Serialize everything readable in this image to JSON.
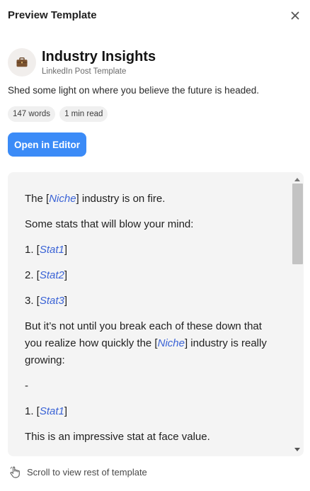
{
  "header": {
    "title": "Preview Template",
    "close_icon": "close-icon"
  },
  "template": {
    "icon": "briefcase-icon",
    "title": "Industry Insights",
    "subtitle": "LinkedIn Post Template",
    "description": "Shed some light on where you believe the future is headed.",
    "badges": [
      "147 words",
      "1 min read"
    ],
    "open_button": "Open in Editor",
    "accent_color": "#3b8bf7",
    "placeholder_color": "#3a63d6"
  },
  "preview": {
    "lines": [
      {
        "parts": [
          {
            "t": "The ["
          },
          {
            "t": "Niche",
            "ph": true
          },
          {
            "t": "] industry is on fire."
          }
        ]
      },
      {
        "parts": [
          {
            "t": "Some stats that will blow your mind:"
          }
        ]
      },
      {
        "parts": [
          {
            "t": "1. ["
          },
          {
            "t": "Stat1",
            "ph": true
          },
          {
            "t": "]"
          }
        ]
      },
      {
        "parts": [
          {
            "t": "2. ["
          },
          {
            "t": "Stat2",
            "ph": true
          },
          {
            "t": "]"
          }
        ]
      },
      {
        "parts": [
          {
            "t": "3. ["
          },
          {
            "t": "Stat3",
            "ph": true
          },
          {
            "t": "]"
          }
        ]
      },
      {
        "parts": [
          {
            "t": "But it’s not until you break each of these down that you realize how quickly the ["
          },
          {
            "t": "Niche",
            "ph": true
          },
          {
            "t": "] industry is really growing:"
          }
        ]
      },
      {
        "parts": [
          {
            "t": "-"
          }
        ]
      },
      {
        "parts": [
          {
            "t": "1. ["
          },
          {
            "t": "Stat1",
            "ph": true
          },
          {
            "t": "]"
          }
        ]
      },
      {
        "parts": [
          {
            "t": "This is an impressive stat at face value."
          }
        ]
      }
    ]
  },
  "scroll_hint": {
    "icon": "hand-pointer-icon",
    "text": "Scroll to view rest of template"
  }
}
